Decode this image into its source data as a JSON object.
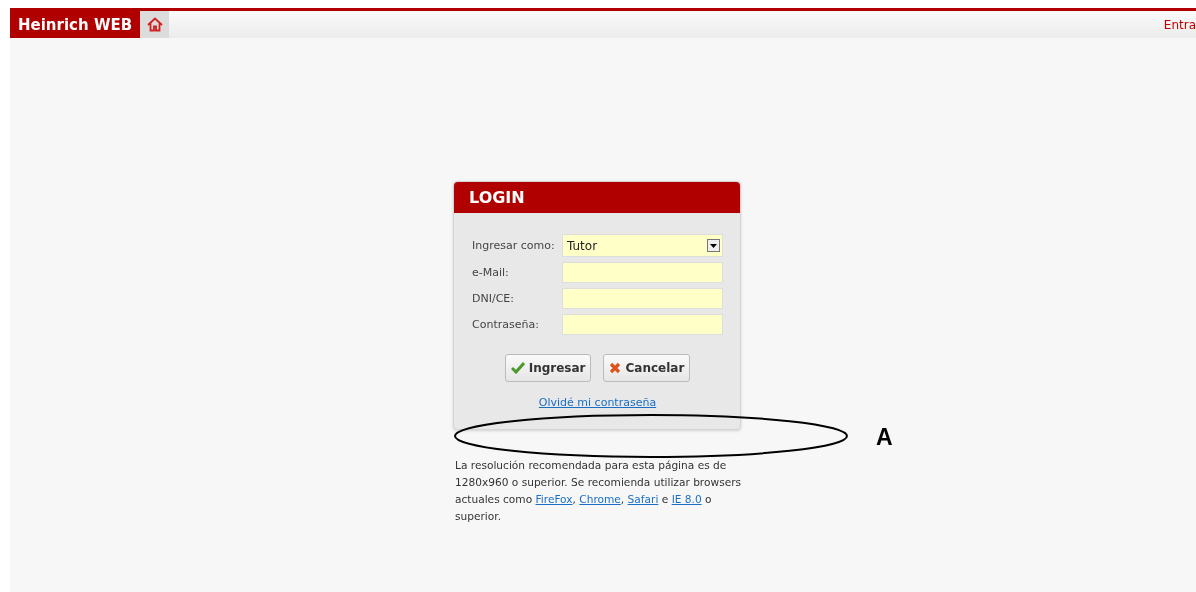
{
  "header": {
    "brand": "Heinrich WEB",
    "login_link": "Entra"
  },
  "login": {
    "title": "LOGIN",
    "fields": [
      {
        "kind": "select",
        "label": "Ingresar como:",
        "value": "Tutor"
      },
      {
        "kind": "text",
        "label": "e-Mail:"
      },
      {
        "kind": "text",
        "label": "DNI/CE:"
      },
      {
        "kind": "password",
        "label": "Contraseña:"
      }
    ],
    "buttons": [
      {
        "kind": "confirm",
        "label": "Ingresar"
      },
      {
        "kind": "cancel",
        "label": "Cancelar"
      }
    ],
    "forgot_link": "Olvidé mi contraseña"
  },
  "note": [
    {
      "kind": "text",
      "text": "La resolución recomendada para esta página es de 1280x960 o superior. Se recomienda utilizar browsers actuales como "
    },
    {
      "kind": "link",
      "text": "FireFox"
    },
    {
      "kind": "text",
      "text": ", "
    },
    {
      "kind": "link",
      "text": "Chrome"
    },
    {
      "kind": "text",
      "text": ", "
    },
    {
      "kind": "link",
      "text": "Safari"
    },
    {
      "kind": "text",
      "text": " e "
    },
    {
      "kind": "link",
      "text": "IE 8.0"
    },
    {
      "kind": "text",
      "text": " o superior."
    }
  ],
  "annotation": {
    "label": "A"
  }
}
